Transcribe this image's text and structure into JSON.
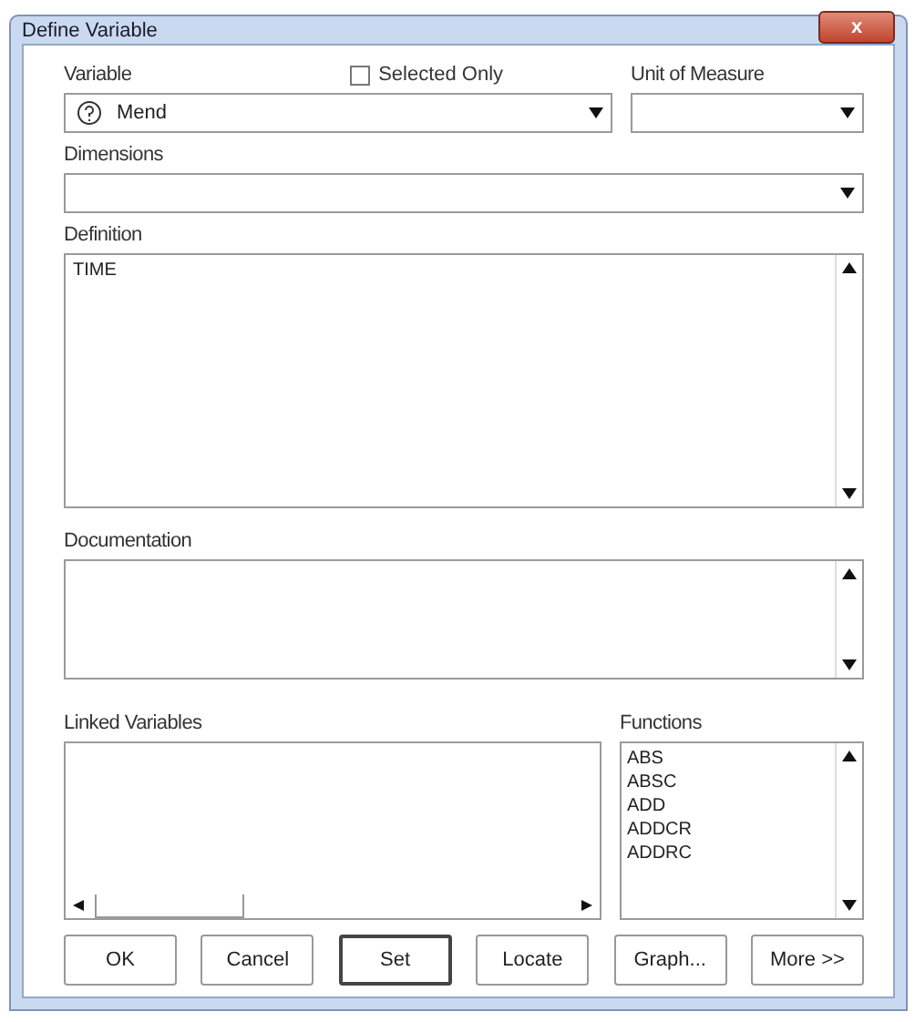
{
  "window": {
    "title": "Define Variable",
    "close": "x"
  },
  "variable": {
    "label": "Variable",
    "value": "Mend"
  },
  "selected_only": {
    "label": "Selected Only",
    "checked": false
  },
  "unit_of_measure": {
    "label": "Unit of Measure"
  },
  "dimensions": {
    "label": "Dimensions"
  },
  "definition": {
    "label": "Definition",
    "value": "TIME"
  },
  "documentation": {
    "label": "Documentation"
  },
  "linked_variables": {
    "label": "Linked Variables"
  },
  "functions": {
    "label": "Functions",
    "items": [
      "ABS",
      "ABSC",
      "ADD",
      "ADDCR",
      "ADDRC"
    ]
  },
  "buttons": [
    {
      "label": "OK",
      "default": false
    },
    {
      "label": "Cancel",
      "default": false
    },
    {
      "label": "Set",
      "default": true
    },
    {
      "label": "Locate",
      "default": false
    },
    {
      "label": "Graph...",
      "default": false
    },
    {
      "label": "More >>",
      "default": false
    }
  ]
}
